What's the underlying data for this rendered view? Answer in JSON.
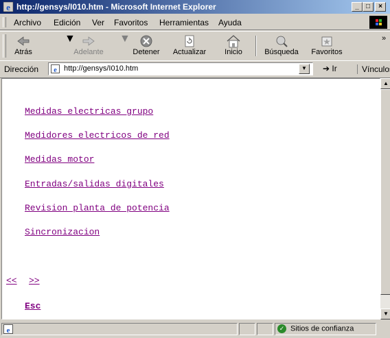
{
  "window": {
    "title": "http://gensys/I010.htm - Microsoft Internet Explorer"
  },
  "title_buttons": {
    "minimize": "_",
    "maximize": "□",
    "close": "×"
  },
  "menu": [
    "Archivo",
    "Edición",
    "Ver",
    "Favoritos",
    "Herramientas",
    "Ayuda"
  ],
  "toolbar": {
    "back": "Atrás",
    "forward": "Adelante",
    "stop": "Detener",
    "refresh": "Actualizar",
    "home": "Inicio",
    "search": "Búsqueda",
    "favorites": "Favoritos"
  },
  "address": {
    "label": "Dirección",
    "url": "http://gensys/I010.htm",
    "go": "Ir",
    "links": "Vínculos"
  },
  "content": {
    "links": [
      "Medidas electricas grupo",
      "Medidores electricos de red",
      "Medidas motor",
      "Entradas/salidas digitales",
      "Revision planta de potencia",
      "Sincronizacion"
    ],
    "nav_prev": "<<",
    "nav_next": ">>",
    "esc": "Esc"
  },
  "status": {
    "zone": "Sitios de confianza"
  }
}
